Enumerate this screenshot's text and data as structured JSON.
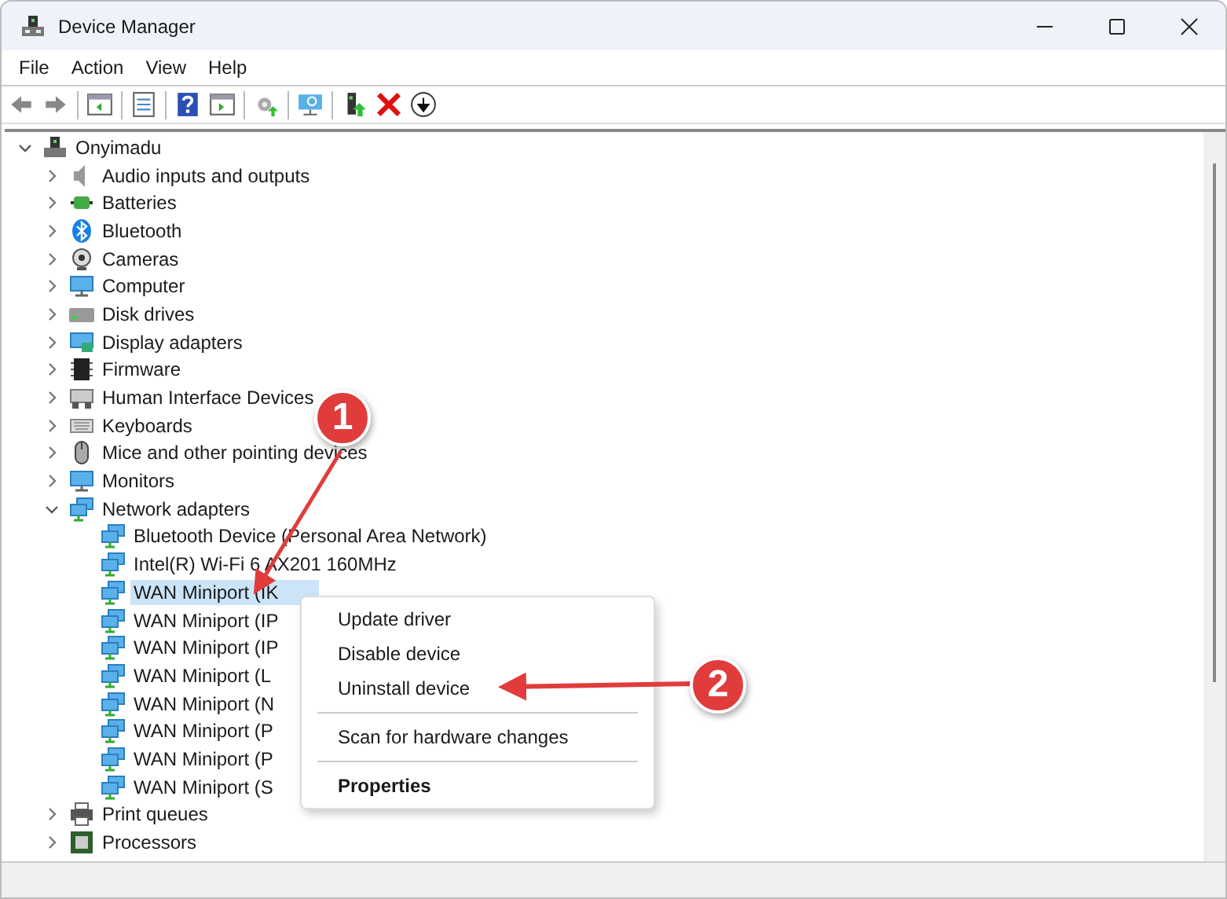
{
  "window": {
    "title": "Device Manager"
  },
  "menu_bar": [
    "File",
    "Action",
    "View",
    "Help"
  ],
  "tree": {
    "label": "Onyimadu",
    "expanded": true,
    "children": [
      {
        "label": "Audio inputs and outputs",
        "expanded": false
      },
      {
        "label": "Batteries",
        "expanded": false
      },
      {
        "label": "Bluetooth",
        "expanded": false
      },
      {
        "label": "Cameras",
        "expanded": false
      },
      {
        "label": "Computer",
        "expanded": false
      },
      {
        "label": "Disk drives",
        "expanded": false
      },
      {
        "label": "Display adapters",
        "expanded": false
      },
      {
        "label": "Firmware",
        "expanded": false
      },
      {
        "label": "Human Interface Devices",
        "expanded": false
      },
      {
        "label": "Keyboards",
        "expanded": false
      },
      {
        "label": "Mice and other pointing devices",
        "expanded": false
      },
      {
        "label": "Monitors",
        "expanded": false
      },
      {
        "label": "Network adapters",
        "expanded": true,
        "children": [
          {
            "label": "Bluetooth Device (Personal Area Network)",
            "selected": false
          },
          {
            "label": "Intel(R) Wi-Fi 6 AX201 160MHz",
            "selected": false
          },
          {
            "label": "WAN Miniport (IK",
            "selected": true
          },
          {
            "label": "WAN Miniport (IP",
            "selected": false
          },
          {
            "label": "WAN Miniport (IP",
            "selected": false
          },
          {
            "label": "WAN Miniport (L",
            "selected": false
          },
          {
            "label": "WAN Miniport (N",
            "selected": false
          },
          {
            "label": "WAN Miniport (P",
            "selected": false
          },
          {
            "label": "WAN Miniport (P",
            "selected": false
          },
          {
            "label": "WAN Miniport (S",
            "selected": false
          }
        ]
      },
      {
        "label": "Print queues",
        "expanded": false
      },
      {
        "label": "Processors",
        "expanded": false
      }
    ]
  },
  "context_menu": [
    {
      "kind": "item",
      "label": "Update driver"
    },
    {
      "kind": "item",
      "label": "Disable device"
    },
    {
      "kind": "item",
      "label": "Uninstall device"
    },
    {
      "kind": "separator"
    },
    {
      "kind": "item",
      "label": "Scan for hardware changes"
    },
    {
      "kind": "separator"
    },
    {
      "kind": "default",
      "label": "Properties"
    }
  ],
  "annotations": [
    "1",
    "2"
  ]
}
